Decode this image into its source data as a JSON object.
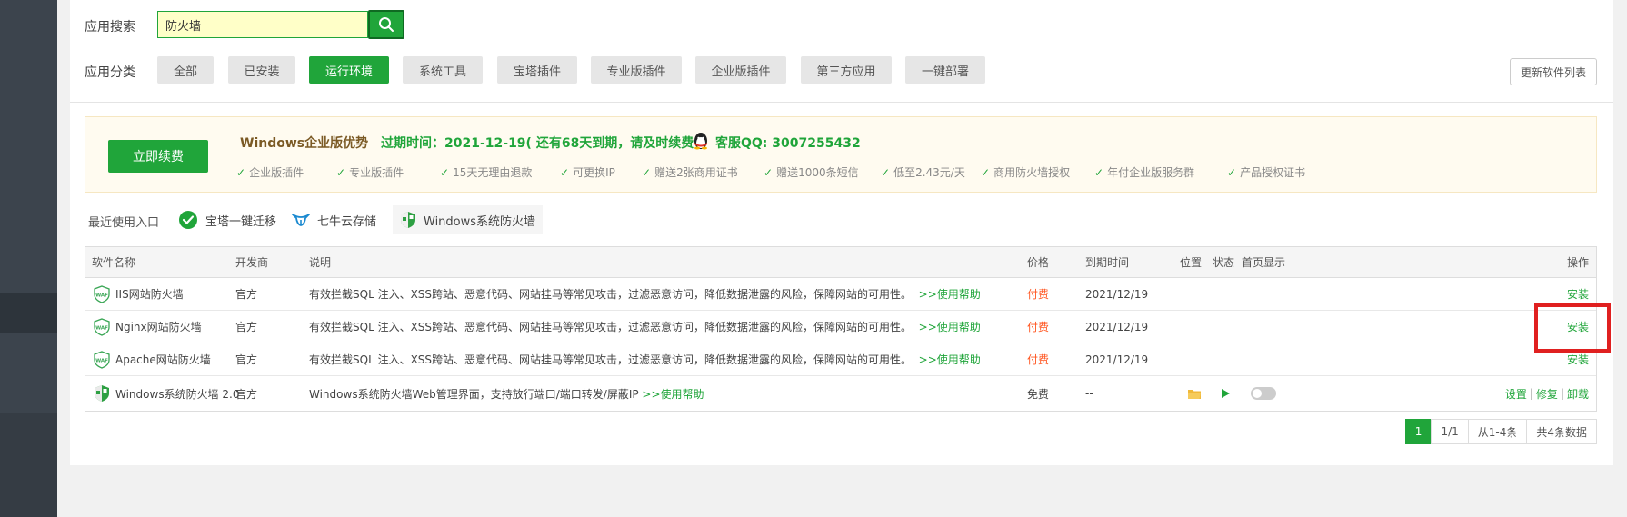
{
  "search": {
    "label": "应用搜索",
    "value": "防火墙"
  },
  "category": {
    "label": "应用分类",
    "items": [
      "全部",
      "已安装",
      "运行环境",
      "系统工具",
      "宝塔插件",
      "专业版插件",
      "企业版插件",
      "第三方应用",
      "一键部署"
    ],
    "active_index": 2,
    "refresh_label": "更新软件列表"
  },
  "promo": {
    "renew_label": "立即续费",
    "title": "Windows企业版优势",
    "expire": "过期时间：2021-12-19( 还有68天到期，请及时续费 )",
    "qq": "客服QQ: 3007255432",
    "features": [
      "企业版插件",
      "专业版插件",
      "15天无理由退款",
      "可更换IP",
      "赠送2张商用证书",
      "赠送1000条短信",
      "低至2.43元/天",
      "商用防火墙授权",
      "年付企业版服务群",
      "产品授权证书"
    ]
  },
  "recent": {
    "label": "最近使用入口",
    "items": [
      "宝塔一键迁移",
      "七牛云存储",
      "Windows系统防火墙"
    ]
  },
  "table": {
    "headers": {
      "name": "软件名称",
      "dev": "开发商",
      "desc": "说明",
      "price": "价格",
      "expire": "到期时间",
      "location": "位置",
      "status": "状态",
      "home": "首页显示",
      "ops": "操作"
    },
    "rows": [
      {
        "name": "IIS网站防火墙",
        "dev": "官方",
        "desc": "有效拦截SQL 注入、XSS跨站、恶意代码、网站挂马等常见攻击，过滤恶意访问，降低数据泄露的风险，保障网站的可用性。",
        "help": ">>使用帮助",
        "price": "付费",
        "expire": "2021/12/19",
        "op": "安装"
      },
      {
        "name": "Nginx网站防火墙",
        "dev": "官方",
        "desc": "有效拦截SQL 注入、XSS跨站、恶意代码、网站挂马等常见攻击，过滤恶意访问，降低数据泄露的风险，保障网站的可用性。",
        "help": ">>使用帮助",
        "price": "付费",
        "expire": "2021/12/19",
        "op": "安装"
      },
      {
        "name": "Apache网站防火墙",
        "dev": "官方",
        "desc": "有效拦截SQL 注入、XSS跨站、恶意代码、网站挂马等常见攻击，过滤恶意访问，降低数据泄露的风险，保障网站的可用性。",
        "help": ">>使用帮助",
        "price": "付费",
        "expire": "2021/12/19",
        "op": "安装"
      },
      {
        "name": "Windows系统防火墙 2.0",
        "dev": "官方",
        "desc": "Windows系统防火墙Web管理界面，支持放行端口/端口转发/屏蔽IP",
        "help": ">>使用帮助",
        "price": "免费",
        "expire": "--",
        "ops": [
          "设置",
          "修复",
          "卸载"
        ],
        "home_display": false
      }
    ]
  },
  "pagination": {
    "current": "1",
    "pages": "1/1",
    "range": "从1-4条",
    "total": "共4条数据"
  },
  "colors": {
    "accent": "#20a53a",
    "paid": "#ff5722",
    "highlight": "#e02020"
  },
  "icons": [
    "search-icon",
    "qq-icon",
    "check-icon",
    "waf-shield-icon",
    "windows-shield-icon",
    "folder-icon",
    "play-icon",
    "migrate-icon",
    "qiniu-icon"
  ]
}
